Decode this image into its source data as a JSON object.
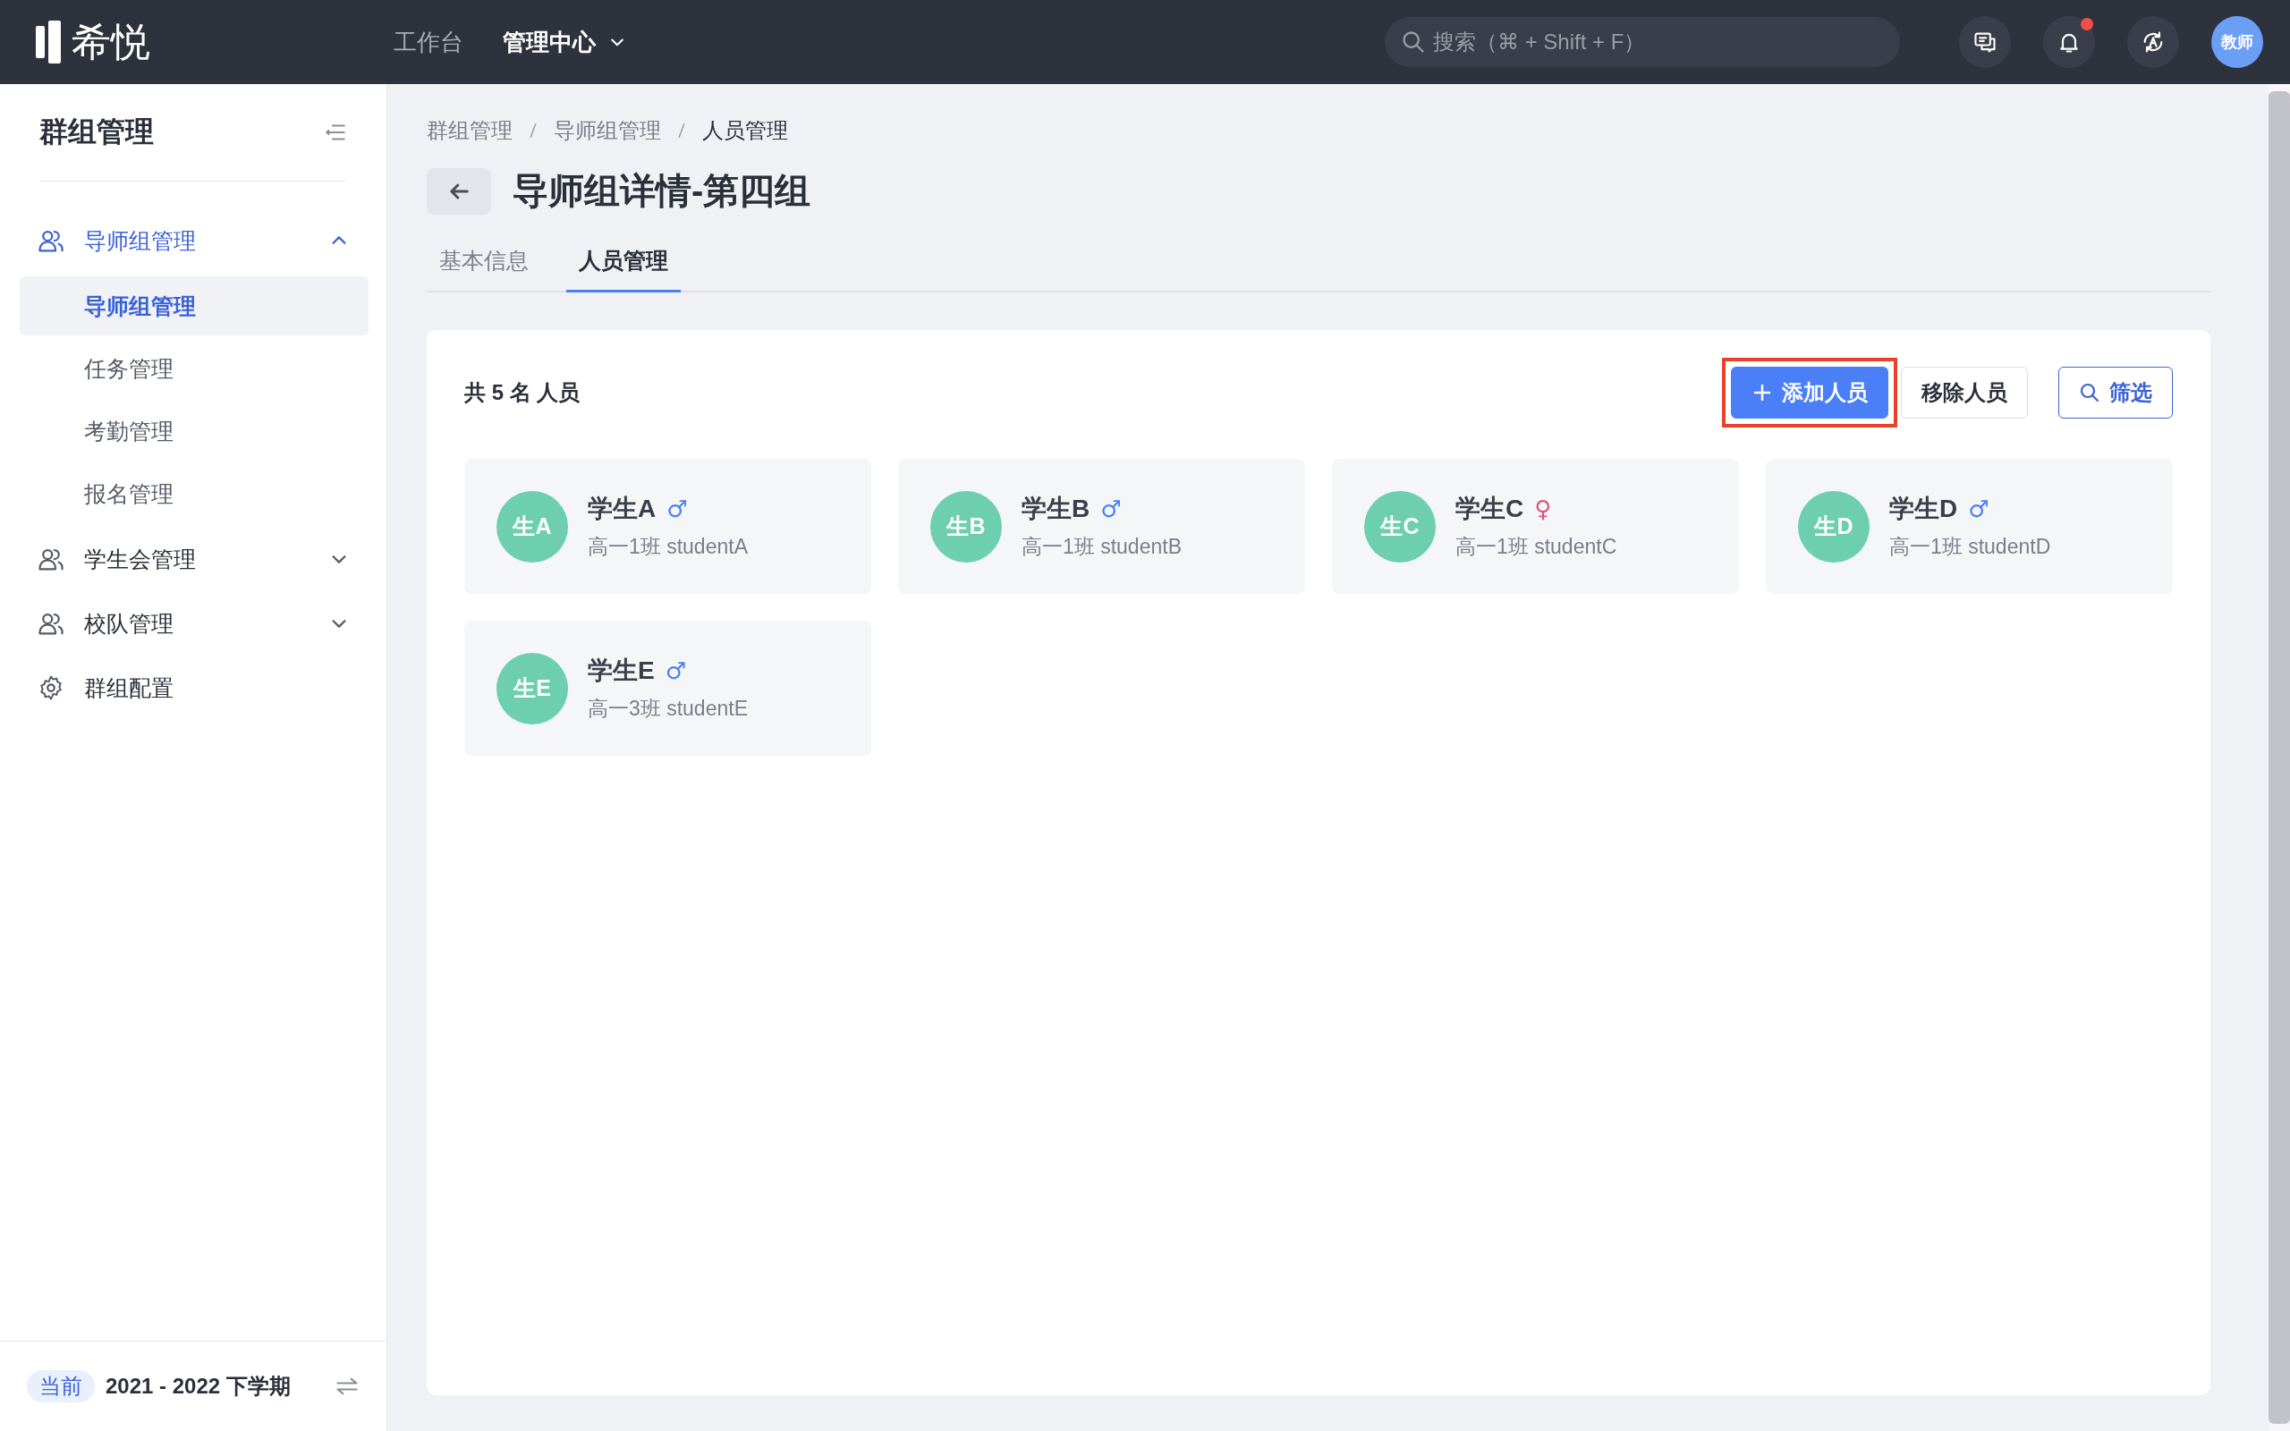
{
  "topbar": {
    "logo": "希悦",
    "nav": [
      {
        "label": "工作台",
        "selected": false,
        "dropdown": false
      },
      {
        "label": "管理中心",
        "selected": true,
        "dropdown": true
      }
    ],
    "search": {
      "placeholder": "搜索（⌘ + Shift + F）"
    },
    "notifications": {
      "unread": true
    },
    "avatar": "教师"
  },
  "sidebar": {
    "title": "群组管理",
    "items": [
      {
        "label": "导师组管理",
        "kind": "group",
        "expanded": true,
        "selected": true,
        "children": [
          {
            "label": "导师组管理",
            "selected": true
          },
          {
            "label": "任务管理",
            "selected": false
          },
          {
            "label": "考勤管理",
            "selected": false
          },
          {
            "label": "报名管理",
            "selected": false
          }
        ]
      },
      {
        "label": "学生会管理",
        "kind": "group",
        "expanded": false,
        "selected": false
      },
      {
        "label": "校队管理",
        "kind": "group",
        "expanded": false,
        "selected": false
      },
      {
        "label": "群组配置",
        "kind": "link",
        "selected": false
      }
    ],
    "term": {
      "badge": "当前",
      "label": "2021 - 2022 下学期"
    }
  },
  "breadcrumb": [
    "群组管理",
    "导师组管理",
    "人员管理"
  ],
  "page_title": "导师组详情-第四组",
  "tabs": [
    {
      "label": "基本信息",
      "selected": false
    },
    {
      "label": "人员管理",
      "selected": true
    }
  ],
  "panel": {
    "count": "共 5 名 人员",
    "buttons": [
      {
        "label": "添加人员",
        "kind": "primary",
        "highlighted": true
      },
      {
        "label": "移除人员",
        "kind": "default",
        "highlighted": false
      },
      {
        "label": "筛选",
        "kind": "filter",
        "highlighted": false
      }
    ],
    "members": [
      {
        "avatar": "生A",
        "name": "学生A",
        "gender_symbol": "♂",
        "color": "#4a7ff7",
        "info": "高一1班 studentA"
      },
      {
        "avatar": "生B",
        "name": "学生B",
        "gender_symbol": "♂",
        "color": "#4a7ff7",
        "info": "高一1班 studentB"
      },
      {
        "avatar": "生C",
        "name": "学生C",
        "gender_symbol": "♀",
        "color": "#d9547a",
        "info": "高一1班 studentC"
      },
      {
        "avatar": "生D",
        "name": "学生D",
        "gender_symbol": "♂",
        "color": "#4a7ff7",
        "info": "高一1班 studentD"
      },
      {
        "avatar": "生E",
        "name": "学生E",
        "gender_symbol": "♂",
        "color": "#4a7ff7",
        "info": "高一3班 studentE"
      }
    ]
  }
}
